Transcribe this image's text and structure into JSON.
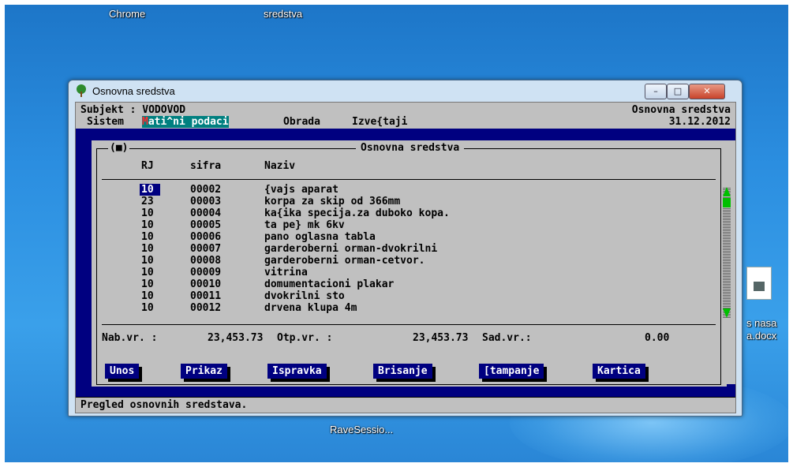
{
  "desktop": {
    "icons": [
      {
        "label": "Chrome"
      },
      {
        "label": "sredstva"
      },
      {
        "label": "RaveSessio..."
      },
      {
        "label_line1": "s nasa",
        "label_line2": "a.docx"
      }
    ]
  },
  "window": {
    "title": "Osnovna sredstva",
    "controls": {
      "minimize": "–",
      "maximize": "□",
      "close": "✕"
    }
  },
  "console": {
    "subject_line": "Subjekt : VODOVOD",
    "right_title": "Osnovna sredstva",
    "date": "31.12.2012",
    "menu": [
      {
        "label": "Sistem"
      },
      {
        "first": "M",
        "rest": "ati^ni podaci"
      },
      {
        "label": "Obrada"
      },
      {
        "label": "Izve{taji"
      }
    ],
    "frame_title": "Osnovna sredstva",
    "frame_marker": "(■)",
    "columns": {
      "rj": "RJ",
      "sifra": "sifra",
      "naziv": "Naziv"
    },
    "rows": [
      {
        "rj": "10",
        "sifra": "00002",
        "naziv": "{vajs aparat"
      },
      {
        "rj": "23",
        "sifra": "00003",
        "naziv": "korpa za skip od 366mm"
      },
      {
        "rj": "10",
        "sifra": "00004",
        "naziv": "ka{ika specija.za duboko kopa."
      },
      {
        "rj": "10",
        "sifra": "00005",
        "naziv": "ta pe} mk 6kv"
      },
      {
        "rj": "10",
        "sifra": "00006",
        "naziv": "pano oglasna tabla"
      },
      {
        "rj": "10",
        "sifra": "00007",
        "naziv": "garderoberni orman-dvokrilni"
      },
      {
        "rj": "10",
        "sifra": "00008",
        "naziv": "garderoberni orman-cetvor."
      },
      {
        "rj": "10",
        "sifra": "00009",
        "naziv": "vitrina"
      },
      {
        "rj": "10",
        "sifra": "00010",
        "naziv": "domumentacioni plakar"
      },
      {
        "rj": "10",
        "sifra": "00011",
        "naziv": "dvokrilni sto"
      },
      {
        "rj": "10",
        "sifra": "00012",
        "naziv": "drvena klupa 4m"
      }
    ],
    "totals": {
      "nab_label": "Nab.vr. :",
      "nab_value": "23,453.73",
      "otp_label": "Otp.vr. :",
      "otp_value": "23,453.73",
      "sad_label": "Sad.vr.:",
      "sad_value": "0.00"
    },
    "buttons": [
      {
        "label": "Unos"
      },
      {
        "label": "Prikaz"
      },
      {
        "label": "Ispravka"
      },
      {
        "label": "Brisanje"
      },
      {
        "label": "[tampanje"
      },
      {
        "label": "Kartica"
      }
    ],
    "status": "Pregled osnovnih sredstava."
  },
  "colors": {
    "console_bg": "#c0c0c0",
    "navy": "#000080",
    "menu_highlight": "#008080",
    "scroll_green": "#00c000"
  }
}
